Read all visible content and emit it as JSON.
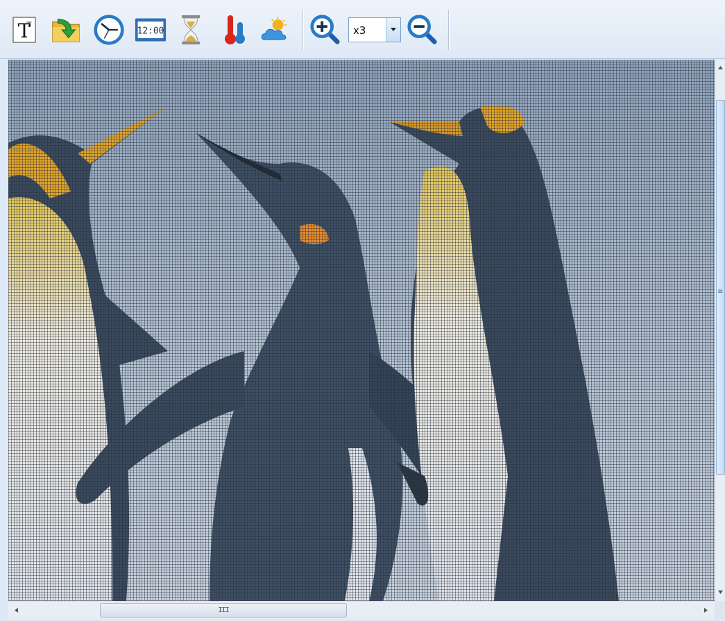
{
  "toolbar": {
    "buttons": [
      {
        "name": "text-tool",
        "icon": "text-T-icon"
      },
      {
        "name": "open-folder",
        "icon": "folder-arrow-icon"
      },
      {
        "name": "analog-clock",
        "icon": "analog-clock-icon"
      },
      {
        "name": "digital-clock",
        "icon": "digital-clock-icon",
        "text": "12:00"
      },
      {
        "name": "timer",
        "icon": "hourglass-icon"
      },
      {
        "name": "temperature",
        "icon": "thermometer-icon"
      },
      {
        "name": "weather",
        "icon": "weather-cloud-sun-icon"
      },
      {
        "name": "zoom-in",
        "icon": "zoom-in-icon"
      },
      {
        "name": "zoom-out",
        "icon": "zoom-out-icon"
      }
    ],
    "zoom": {
      "value": "x3",
      "options": [
        "x3"
      ]
    }
  },
  "scrollbars": {
    "horizontal_grip": "III",
    "vertical_grip": "≡"
  },
  "colors": {
    "toolbar_bg": "#dfe9f5",
    "accent_blue": "#2a7ac8",
    "thermo_red": "#d9261c",
    "hourglass_sand": "#d4b04a"
  }
}
